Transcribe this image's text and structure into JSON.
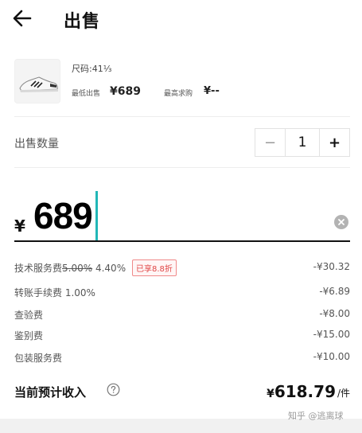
{
  "header": {
    "title": "出售",
    "back_icon": "arrow-left-icon"
  },
  "product": {
    "size": "尺码:41⅓",
    "lowest_sell_label": "最低出售",
    "lowest_sell_value": "¥689",
    "highest_bid_label": "最高求购",
    "highest_bid_value": "¥--",
    "thumbnail_icon": "sneaker-icon"
  },
  "quantity": {
    "label": "出售数量",
    "minus": "−",
    "value": "1",
    "plus": "+"
  },
  "price_input": {
    "currency": "¥",
    "value": "689",
    "clear_icon": "clear-icon"
  },
  "fees": [
    {
      "name": "技术服务费",
      "original_rate": "5.00%",
      "rate": "4.40%",
      "badge": "已享8.8折",
      "amount": "-¥30.32"
    },
    {
      "name": "转账手续费 1.00%",
      "amount": "-¥6.89"
    },
    {
      "name": "查验费",
      "amount": "-¥8.00"
    },
    {
      "name": "鉴别费",
      "amount": "-¥15.00"
    },
    {
      "name": "包装服务费",
      "amount": "-¥10.00"
    }
  ],
  "total": {
    "label": "当前预计收入",
    "help_icon": "help-circle-icon",
    "currency": "¥",
    "value": "618.79",
    "unit": "/件"
  },
  "watermark": "知乎 @逃离球",
  "colors": {
    "accent_caret": "#21b7b7",
    "discount_red": "#e04545"
  }
}
